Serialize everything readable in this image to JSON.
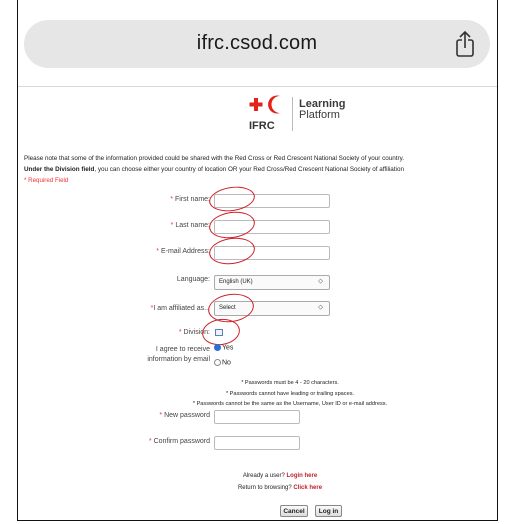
{
  "browser": {
    "url": "ifrc.csod.com"
  },
  "branding": {
    "org_short": "IFRC",
    "product_line1": "Learning",
    "product_line2": "Platform"
  },
  "notice": {
    "line1": "Please note that some of the information provided could be shared with the Red Cross or Red Crescent National Society of your country.",
    "line2_bold": "Under the Division field",
    "line2_rest": ", you can choose either your country of location OR your Red Cross/Red Crescent National Society of affiliation",
    "required": "* Required Field"
  },
  "form": {
    "first_name_label": "First name:",
    "last_name_label": "Last name:",
    "email_label": "E-mail Address:",
    "language_label": "Language:",
    "language_value": "English (UK)",
    "affiliated_label": "I am affiliated as...",
    "affiliated_value": "Select",
    "division_label": "Division:",
    "receive_label_1": "I agree to receive",
    "receive_label_2": "information by email",
    "radio_yes": "Yes",
    "radio_no": "No",
    "new_password_label": "New password",
    "confirm_password_label": "Confirm password",
    "star": "*"
  },
  "password_rules": [
    "* Passwords must be 4 - 20 characters.",
    "* Passwords cannot have leading or trailing spaces.",
    "* Passwords cannot be the same as the Username, User ID or e-mail address."
  ],
  "links": {
    "already_user": "Already a user?",
    "login_here": "Login here",
    "return_browsing": "Return to browsing?",
    "click_here": "Click here"
  },
  "buttons": {
    "cancel": "Cancel",
    "login": "Log in"
  },
  "colors": {
    "accent_red": "#e32219",
    "annotation_red": "#d0202a",
    "radio_blue": "#2a6fd6"
  }
}
